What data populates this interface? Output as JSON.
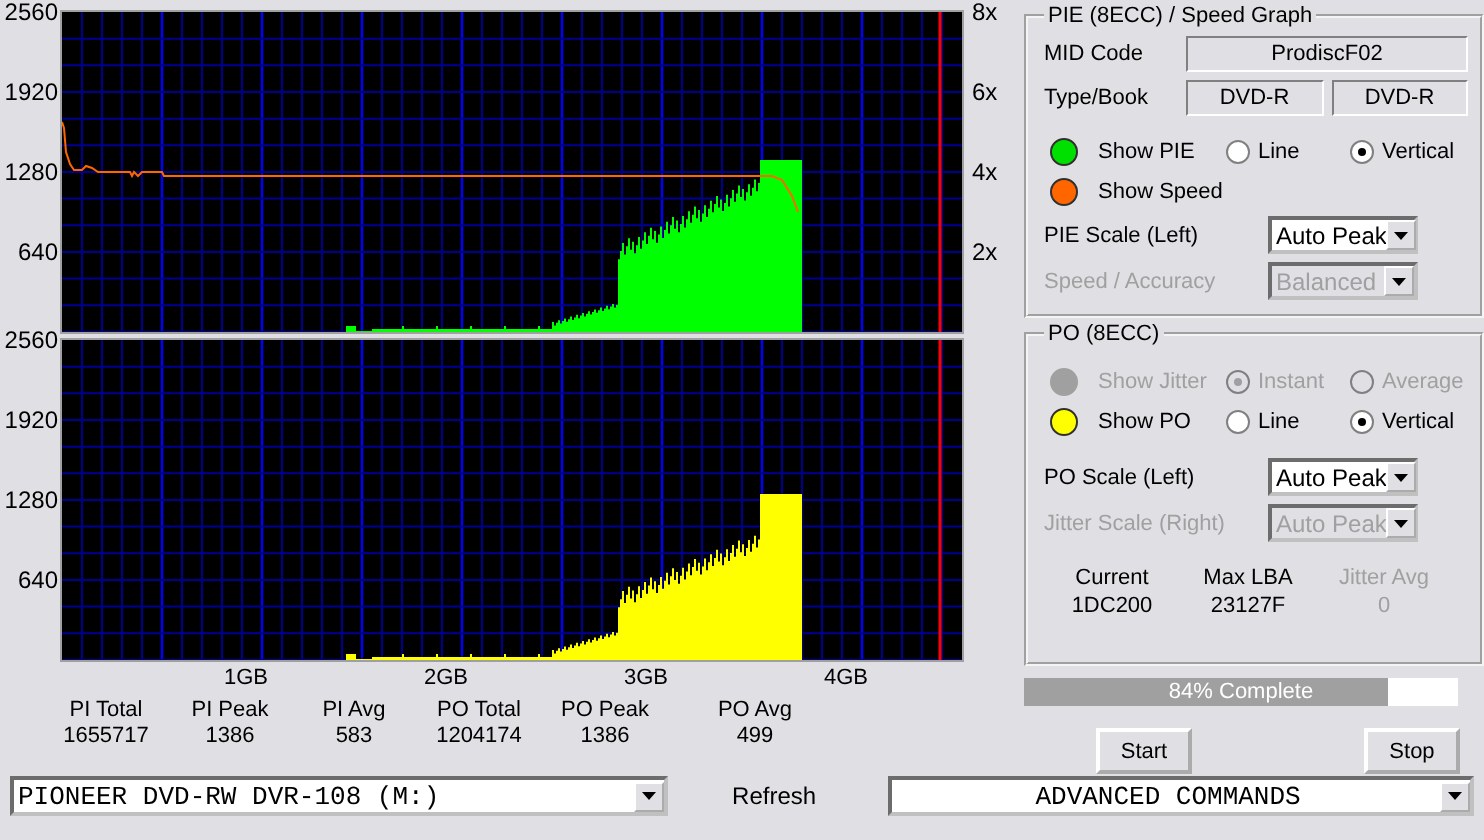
{
  "pie_graph": {
    "y_labels": [
      "2560",
      "1920",
      "1280",
      "640"
    ],
    "speed_labels": [
      "8x",
      "6x",
      "4x",
      "2x"
    ]
  },
  "po_graph": {
    "y_labels": [
      "2560",
      "1920",
      "1280",
      "640"
    ]
  },
  "x_labels": [
    "1GB",
    "2GB",
    "3GB",
    "4GB"
  ],
  "stats": [
    {
      "label": "PI Total",
      "value": "1655717"
    },
    {
      "label": "PI Peak",
      "value": "1386"
    },
    {
      "label": "PI Avg",
      "value": "583"
    },
    {
      "label": "PO Total",
      "value": "1204174"
    },
    {
      "label": "PO Peak",
      "value": "1386"
    },
    {
      "label": "PO Avg",
      "value": "499"
    }
  ],
  "pie_panel": {
    "title": "PIE (8ECC) / Speed Graph",
    "mid_label": "MID Code",
    "mid_value": "ProdiscF02",
    "type_label": "Type/Book",
    "type_values": [
      "DVD-R",
      "DVD-R"
    ],
    "toggles": [
      {
        "label": "Show PIE",
        "color": "#00e000",
        "disabled": false,
        "modes": [
          {
            "label": "Line",
            "selected": false,
            "disabled": false
          },
          {
            "label": "Vertical",
            "selected": true,
            "disabled": false
          }
        ]
      },
      {
        "label": "Show Speed",
        "color": "#ff6600",
        "disabled": false
      }
    ],
    "dropdowns": [
      {
        "label": "PIE Scale (Left)",
        "value": "Auto Peak",
        "disabled": false
      },
      {
        "label": "Speed / Accuracy",
        "value": "Balanced",
        "disabled": true
      }
    ]
  },
  "po_panel": {
    "title": "PO (8ECC)",
    "toggles": [
      {
        "label": "Show Jitter",
        "color": "#a0a0a0",
        "disabled": true,
        "modes": [
          {
            "label": "Instant",
            "selected": true,
            "disabled": true
          },
          {
            "label": "Average",
            "selected": false,
            "disabled": true
          }
        ]
      },
      {
        "label": "Show PO",
        "color": "#ffff00",
        "disabled": false,
        "modes": [
          {
            "label": "Line",
            "selected": false,
            "disabled": false
          },
          {
            "label": "Vertical",
            "selected": true,
            "disabled": false
          }
        ]
      }
    ],
    "dropdowns": [
      {
        "label": "PO Scale (Left)",
        "value": "Auto Peak",
        "disabled": false
      },
      {
        "label": "Jitter Scale (Right)",
        "value": "Auto Peak",
        "disabled": true
      }
    ],
    "readouts": [
      {
        "label": "Current",
        "value": "1DC200",
        "disabled": false
      },
      {
        "label": "Max LBA",
        "value": "23127F",
        "disabled": false
      },
      {
        "label": "Jitter Avg",
        "value": "0",
        "disabled": true
      }
    ]
  },
  "progress": {
    "label": "84% Complete",
    "level": 0.84
  },
  "buttons": [
    "Start",
    "Stop"
  ],
  "drive": {
    "value": "PIONEER DVD-RW  DVR-108  (M:)"
  },
  "refresh": "Refresh",
  "commands": {
    "value": "ADVANCED COMMANDS"
  }
}
